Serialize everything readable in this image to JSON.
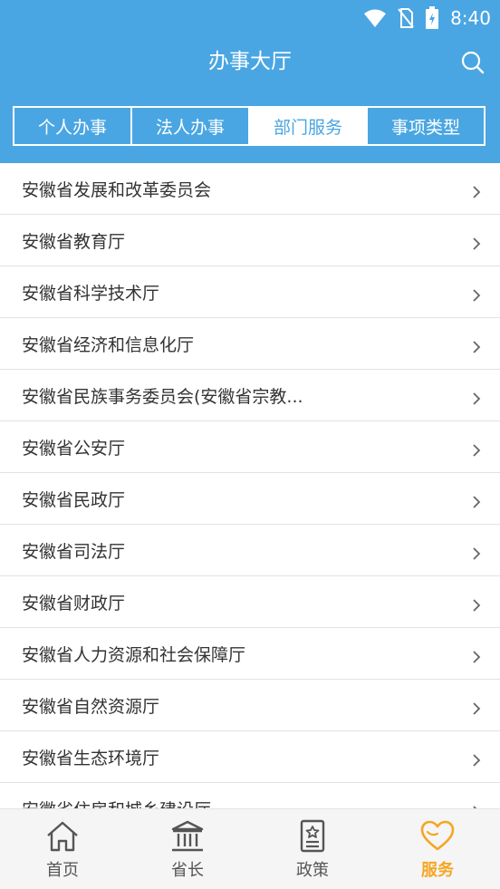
{
  "status": {
    "time": "8:40"
  },
  "header": {
    "title": "办事大厅"
  },
  "tabs": [
    {
      "label": "个人办事"
    },
    {
      "label": "法人办事"
    },
    {
      "label": "部门服务",
      "active": true
    },
    {
      "label": "事项类型"
    }
  ],
  "list": [
    "安徽省发展和改革委员会",
    "安徽省教育厅",
    "安徽省科学技术厅",
    "安徽省经济和信息化厅",
    "安徽省民族事务委员会(安徽省宗教...",
    "安徽省公安厅",
    "安徽省民政厅",
    "安徽省司法厅",
    "安徽省财政厅",
    "安徽省人力资源和社会保障厅",
    "安徽省自然资源厅",
    "安徽省生态环境厅",
    "安徽省住房和城乡建设厅"
  ],
  "tabbar": [
    {
      "label": "首页",
      "icon": "home-icon"
    },
    {
      "label": "省长",
      "icon": "building-icon"
    },
    {
      "label": "政策",
      "icon": "document-icon"
    },
    {
      "label": "服务",
      "icon": "heart-icon",
      "active": true
    }
  ],
  "colors": {
    "primary": "#4aa6e2",
    "accent": "#f5a623"
  }
}
